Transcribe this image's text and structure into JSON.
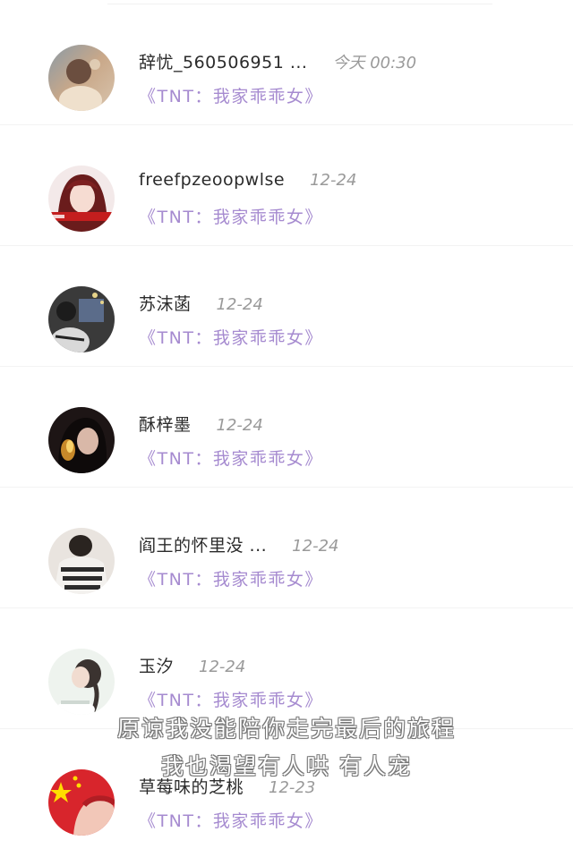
{
  "conversations": [
    {
      "name": "辞忧_560506951 ...",
      "time": "今天 00:30",
      "subtitle": "《TNT：我家乖乖女》"
    },
    {
      "name": "freefpzeoopwlse",
      "time": "12-24",
      "subtitle": "《TNT：我家乖乖女》"
    },
    {
      "name": "苏沫菡",
      "time": "12-24",
      "subtitle": "《TNT：我家乖乖女》"
    },
    {
      "name": "酥梓墨",
      "time": "12-24",
      "subtitle": "《TNT：我家乖乖女》"
    },
    {
      "name": "阎王的怀里没 ...",
      "time": "12-24",
      "subtitle": "《TNT：我家乖乖女》"
    },
    {
      "name": "玉汐",
      "time": "12-24",
      "subtitle": "《TNT：我家乖乖女》"
    },
    {
      "name": "草莓味的芝桃",
      "time": "12-23",
      "subtitle": "《TNT：我家乖乖女》"
    }
  ],
  "overlay": {
    "line1": "原谅我没能陪你走完最后的旅程",
    "line2": "我也渴望有人哄 有人宠"
  },
  "colors": {
    "subtitle": "#a68bd0",
    "name": "#2b2b2b",
    "time": "#9a9a9a"
  }
}
